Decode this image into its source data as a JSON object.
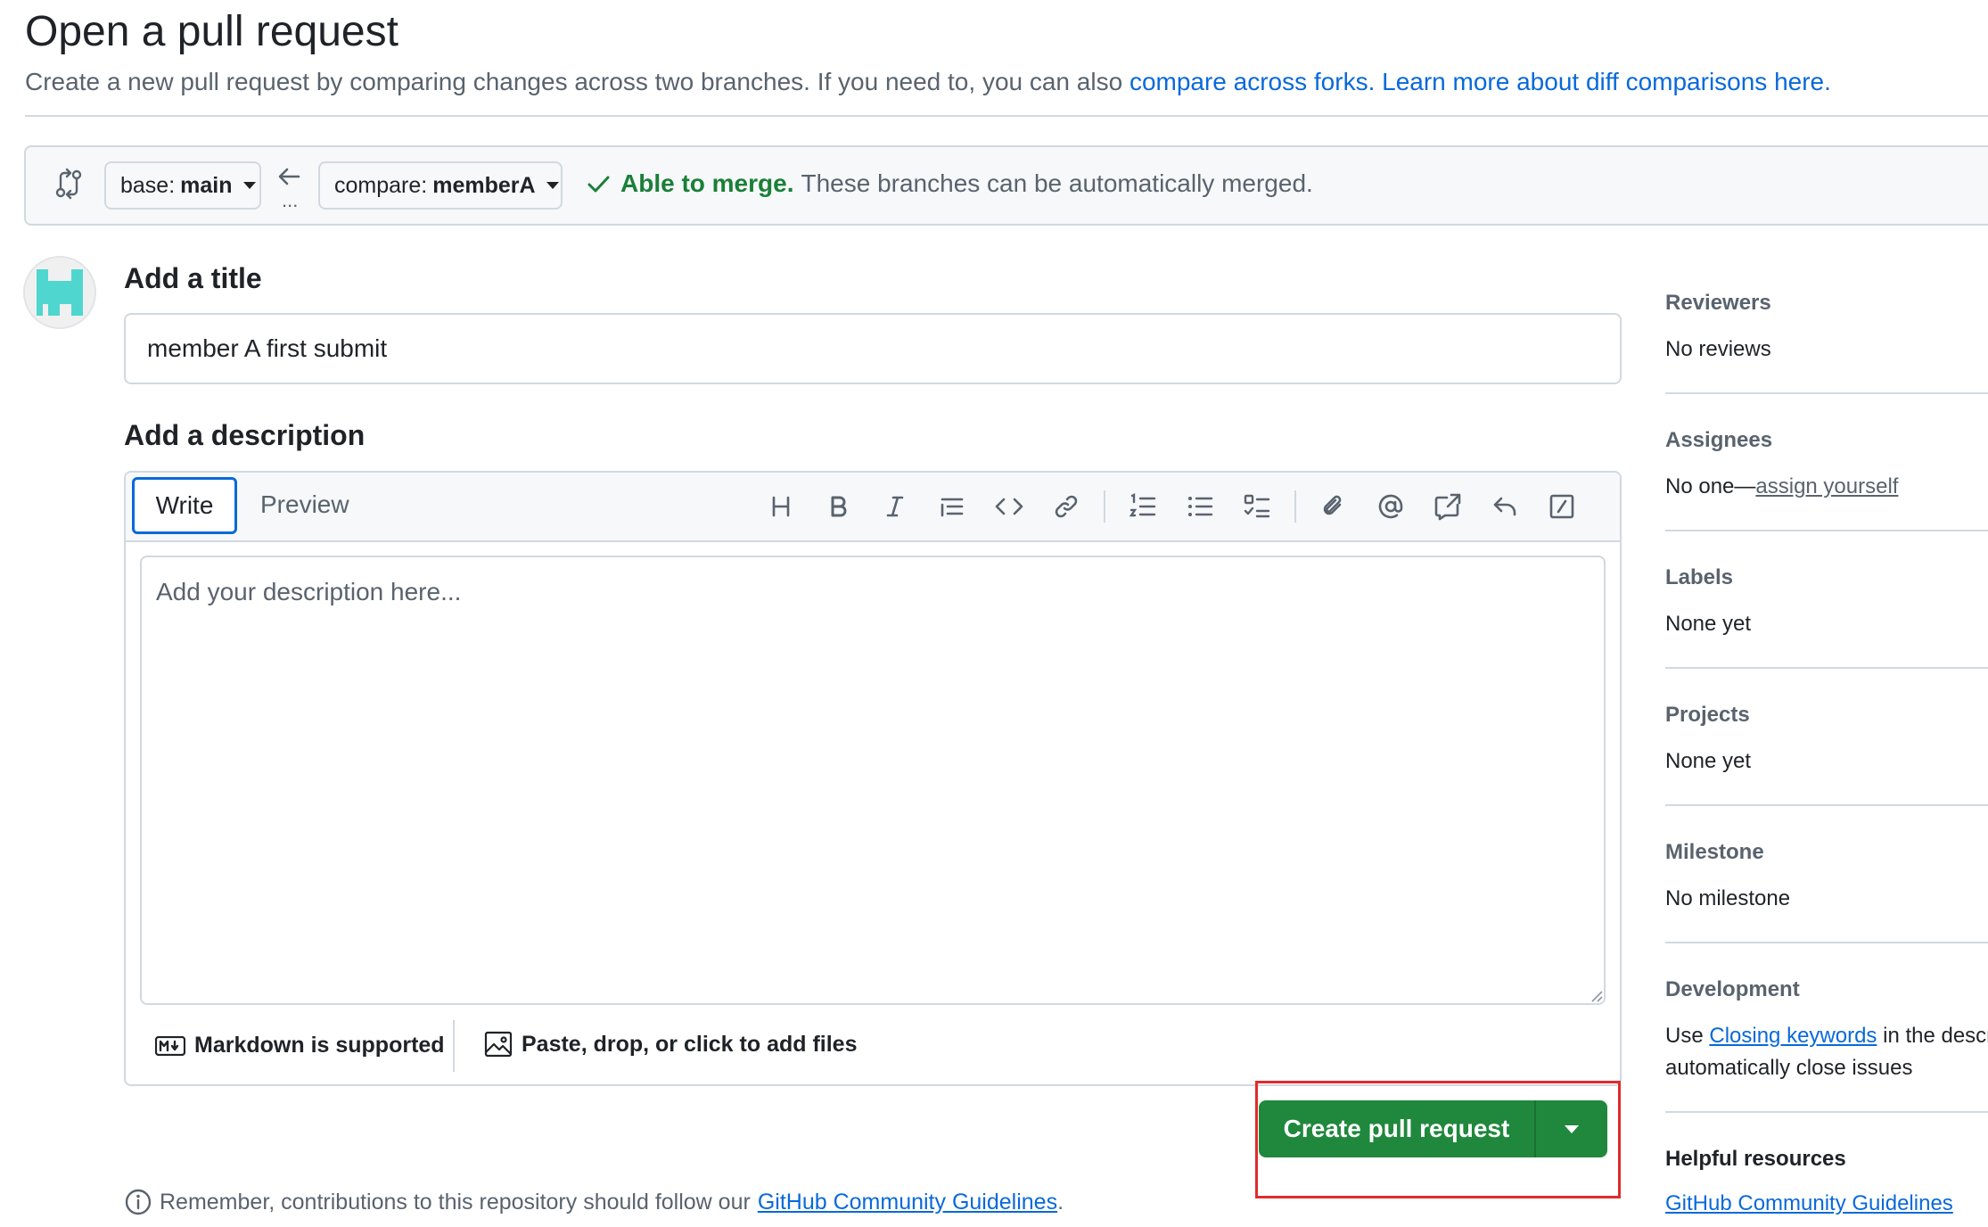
{
  "header": {
    "title": "Open a pull request",
    "description": "Create a new pull request by comparing changes across two branches. If you need to, you can also",
    "link_forks": "compare across forks.",
    "link_learn": "Learn more about diff comparisons here."
  },
  "compare": {
    "base_prefix": "base:",
    "base_branch": "main",
    "compare_prefix": "compare:",
    "compare_branch": "memberA",
    "ellipsis": "...",
    "merge_status": "Able to merge.",
    "merge_detail": "These branches can be automatically merged."
  },
  "form": {
    "title_label": "Add a title",
    "title_value": "member A first submit",
    "description_label": "Add a description",
    "tab_write": "Write",
    "tab_preview": "Preview",
    "description_placeholder": "Add your description here...",
    "markdown_note": "Markdown is supported",
    "attach_note": "Paste, drop, or click to add files"
  },
  "toolbar": {
    "icons": [
      "heading-icon",
      "bold-icon",
      "italic-icon",
      "quote-icon",
      "code-icon",
      "link-icon",
      "ordered-list-icon",
      "unordered-list-icon",
      "task-list-icon",
      "attach-icon",
      "mention-icon",
      "reference-icon",
      "reply-icon",
      "slash-command-icon"
    ]
  },
  "actions": {
    "create_label": "Create pull request"
  },
  "footer": {
    "remember_text": "Remember, contributions to this repository should follow our",
    "guidelines_link": "GitHub Community Guidelines",
    "period": "."
  },
  "sidebar": {
    "reviewers_title": "Reviewers",
    "reviewers_value": "No reviews",
    "assignees_title": "Assignees",
    "assignees_value": "No one—",
    "assign_yourself": "assign yourself",
    "labels_title": "Labels",
    "labels_value": "None yet",
    "projects_title": "Projects",
    "projects_value": "None yet",
    "milestone_title": "Milestone",
    "milestone_value": "No milestone",
    "development_title": "Development",
    "development_use": "Use",
    "development_link": "Closing keywords",
    "development_rest": "in the descr",
    "development_line2": "automatically close issues",
    "helpful_title": "Helpful resources",
    "helpful_link": "GitHub Community Guidelines"
  },
  "colors": {
    "accent": "#0969da",
    "success": "#1a7f37",
    "primary_button": "#1f883d",
    "highlight_box": "#e02b2b"
  }
}
